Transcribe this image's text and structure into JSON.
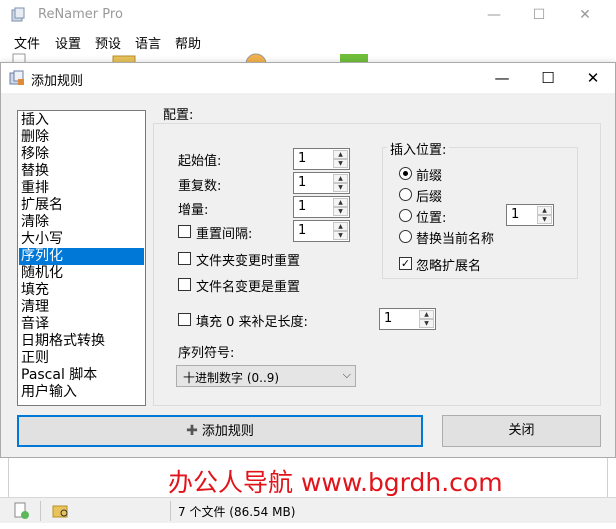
{
  "main_window": {
    "title": "ReNamer Pro",
    "menu": [
      "文件",
      "设置",
      "预设",
      "语言",
      "帮助"
    ],
    "status_text": "7 个文件 (86.54 MB)"
  },
  "dialog": {
    "title": "添加规则",
    "rules": [
      "插入",
      "删除",
      "移除",
      "替换",
      "重排",
      "扩展名",
      "清除",
      "大小写",
      "序列化",
      "随机化",
      "填充",
      "清理",
      "音译",
      "日期格式转换",
      "正则",
      "Pascal 脚本",
      "用户输入"
    ],
    "selected_rule": "序列化",
    "config_label": "配置:",
    "start_label": "起始值:",
    "start_value": "1",
    "repeat_label": "重复数:",
    "repeat_value": "1",
    "step_label": "增量:",
    "step_value": "1",
    "reset_every_label": "重置间隔:",
    "reset_every_value": "1",
    "reset_folder_label": "文件夹变更时重置",
    "reset_name_label": "文件名变更是重置",
    "pad_label": "填充 0 来补足长度:",
    "pad_value": "1",
    "numeral_label": "序列符号:",
    "numeral_value": "十进制数字 (0..9)",
    "insert_group": {
      "title": "插入位置:",
      "prefix": "前缀",
      "suffix": "后缀",
      "position": "位置:",
      "position_value": "1",
      "replace": "替换当前名称",
      "ignore_ext": "忽略扩展名"
    },
    "add_button": "添加规则",
    "close_button": "关闭"
  },
  "watermark": "办公人导航 www.bgrdh.com",
  "colors": {
    "selection": "#0078d7",
    "watermark": "#e0141a",
    "dialog_bg": "#f0f0f0"
  }
}
